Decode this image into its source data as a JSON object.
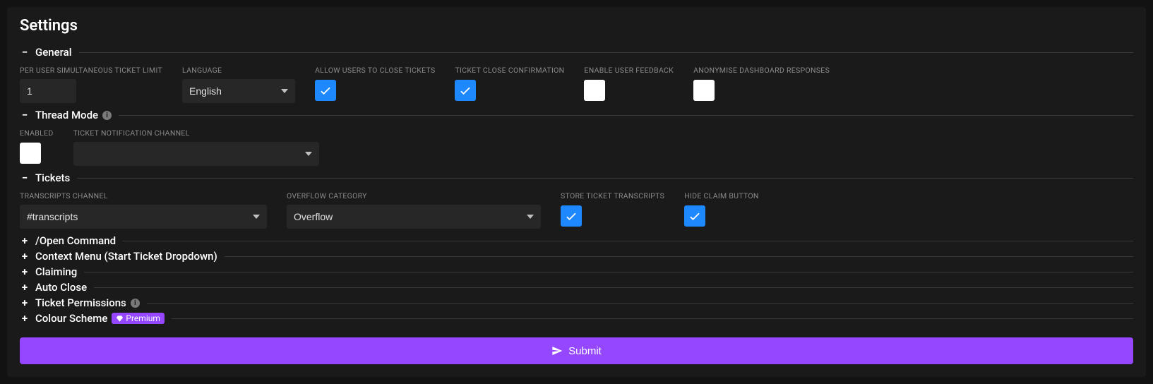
{
  "title": "Settings",
  "sections": {
    "general": {
      "title": "General",
      "per_user_label": "PER USER SIMULTANEOUS TICKET LIMIT",
      "per_user_value": "1",
      "language_label": "LANGUAGE",
      "language_value": "English",
      "allow_close_label": "ALLOW USERS TO CLOSE TICKETS",
      "allow_close_checked": true,
      "close_confirm_label": "TICKET CLOSE CONFIRMATION",
      "close_confirm_checked": true,
      "user_feedback_label": "ENABLE USER FEEDBACK",
      "user_feedback_checked": false,
      "anonymise_label": "ANONYMISE DASHBOARD RESPONSES",
      "anonymise_checked": false
    },
    "thread_mode": {
      "title": "Thread Mode",
      "enabled_label": "ENABLED",
      "enabled_checked": false,
      "notif_channel_label": "TICKET NOTIFICATION CHANNEL",
      "notif_channel_value": ""
    },
    "tickets": {
      "title": "Tickets",
      "transcripts_channel_label": "TRANSCRIPTS CHANNEL",
      "transcripts_channel_value": "#transcripts",
      "overflow_label": "OVERFLOW CATEGORY",
      "overflow_value": "Overflow",
      "store_transcripts_label": "STORE TICKET TRANSCRIPTS",
      "store_transcripts_checked": true,
      "hide_claim_label": "HIDE CLAIM BUTTON",
      "hide_claim_checked": true
    },
    "open_command": {
      "title": "/Open Command"
    },
    "context_menu": {
      "title": "Context Menu (Start Ticket Dropdown)"
    },
    "claiming": {
      "title": "Claiming"
    },
    "auto_close": {
      "title": "Auto Close"
    },
    "ticket_permissions": {
      "title": "Ticket Permissions"
    },
    "colour_scheme": {
      "title": "Colour Scheme",
      "premium_label": "Premium"
    }
  },
  "submit_label": "Submit"
}
